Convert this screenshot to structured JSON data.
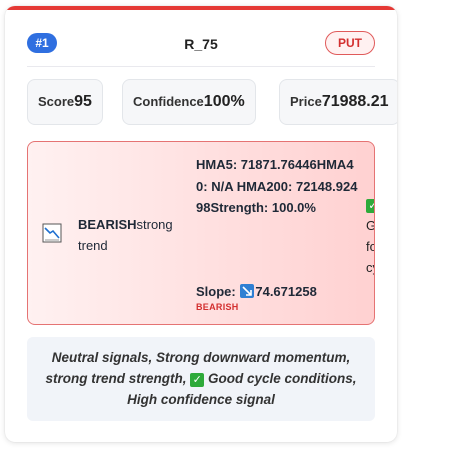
{
  "card": {
    "rank": "#1",
    "symbol": "R_75",
    "direction": "PUT"
  },
  "metrics": [
    {
      "label": "Score",
      "value": "95"
    },
    {
      "label": "Confidence",
      "value": "100%"
    },
    {
      "label": "Price",
      "value": "71988.21"
    }
  ],
  "trend": {
    "direction": "BEARISH",
    "strength_text": "strong trend",
    "hma5_label": "HMA5:",
    "hma5_value": "71871.76446",
    "hma40_label": "HMA40:",
    "hma40_value": "N/A",
    "hma200_label": "HMA200:",
    "hma200_value": "72148.92498",
    "strength_label": "Strength:",
    "strength_value": "100.0%",
    "slope_label": "Slope:",
    "slope_value": "74.671258",
    "slope_direction": "BEARISH",
    "cycle_lines": [
      "Good",
      "for",
      "cycle"
    ]
  },
  "summary": {
    "part1": "Neutral signals, Strong downward momentum, strong trend strength,",
    "part2": "Good cycle conditions, High confidence signal"
  },
  "colors": {
    "accent_red": "#e53935",
    "rank_blue": "#2f6fe0",
    "check_green": "#2eaa3a"
  }
}
